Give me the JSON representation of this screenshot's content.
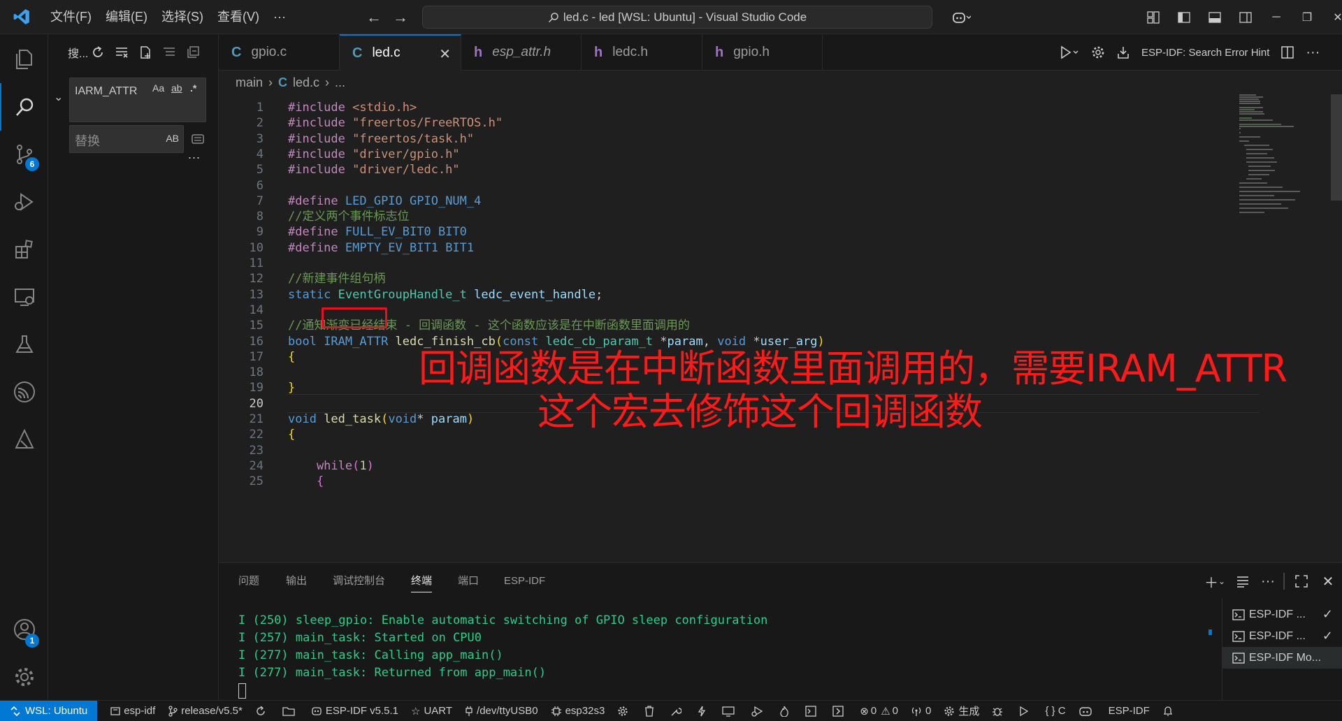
{
  "titlebar": {
    "menus": [
      "文件(F)",
      "编辑(E)",
      "选择(S)",
      "查看(V)",
      "···"
    ],
    "search_text": "led.c - led [WSL: Ubuntu] - Visual Studio Code"
  },
  "activitybar": {
    "items": [
      {
        "name": "explorer-icon"
      },
      {
        "name": "search-icon"
      },
      {
        "name": "source-control-icon",
        "badge": "6"
      },
      {
        "name": "run-debug-icon"
      },
      {
        "name": "extensions-icon"
      },
      {
        "name": "remote-explorer-icon"
      },
      {
        "name": "testing-icon"
      },
      {
        "name": "esp-idf-icon"
      },
      {
        "name": "esp-idf-explorer-icon"
      }
    ],
    "accounts_badge": "1"
  },
  "sidebar": {
    "title": "搜...",
    "find_value": "IARM_ATTR",
    "find_opts": [
      "Aa",
      "ab",
      ".*"
    ],
    "replace_placeholder": "替换",
    "replace_opt": "AB",
    "more": "..."
  },
  "tabs": [
    {
      "icon": "C",
      "label": "gpio.c",
      "active": false
    },
    {
      "icon": "C",
      "label": "led.c",
      "active": true
    },
    {
      "icon": "h",
      "label": "esp_attr.h",
      "active": false
    },
    {
      "icon": "h",
      "label": "ledc.h",
      "active": false
    },
    {
      "icon": "h",
      "label": "gpio.h",
      "active": false
    }
  ],
  "editor_actions": {
    "hint_label": "ESP-IDF: Search Error Hint"
  },
  "breadcrumb": {
    "folder": "main",
    "file": "led.c",
    "rest": "..."
  },
  "editor": {
    "line_numbers": [
      "1",
      "2",
      "3",
      "4",
      "5",
      "6",
      "7",
      "8",
      "9",
      "10",
      "11",
      "12",
      "13",
      "14",
      "15",
      "16",
      "17",
      "18",
      "19",
      "20",
      "21",
      "22",
      "23",
      "24",
      "25"
    ],
    "current_line": "20",
    "lines": {
      "l1": {
        "a": "#include",
        "b": " <stdio.h>"
      },
      "l2": {
        "a": "#include",
        "b": " \"freertos/FreeRTOS.h\""
      },
      "l3": {
        "a": "#include",
        "b": " \"freertos/task.h\""
      },
      "l4": {
        "a": "#include",
        "b": " \"driver/gpio.h\""
      },
      "l5": {
        "a": "#include",
        "b": " \"driver/ledc.h\""
      },
      "l7": {
        "a": "#define",
        "b": " LED_GPIO",
        "c": " GPIO_NUM_4"
      },
      "l8": {
        "a": "//定义两个事件标志位"
      },
      "l9": {
        "a": "#define",
        "b": " FULL_EV_BIT0",
        "c": " BIT0"
      },
      "l10": {
        "a": "#define",
        "b": " EMPTY_EV_BIT1",
        "c": " BIT1"
      },
      "l12": {
        "a": "//新建事件组句柄"
      },
      "l13": {
        "a": "static",
        "b": " EventGroupHandle_t",
        "c": " ledc_event_handle",
        "d": ";"
      },
      "l15": {
        "a": "//通知渐变已经结束 - 回调函数 - 这个函数应该是在中断函数里面调用的"
      },
      "l16": {
        "a": "bool",
        "b": " IRAM_ATTR",
        "c": " ledc_finish_cb",
        "d": "(",
        "e": "const",
        "f": " ledc_cb_param_t",
        "g": " *",
        "h": "param",
        "i": ", ",
        "j": "void",
        "k": " *",
        "l": "user_arg",
        "m": ")"
      },
      "l17": {
        "a": "{"
      },
      "l19": {
        "a": "}"
      },
      "l21": {
        "a": "void",
        "b": " led_task",
        "c": "(",
        "d": "void",
        "e": "* ",
        "f": "param",
        "g": ")"
      },
      "l22": {
        "a": "{"
      },
      "l24": {
        "a": "    while",
        "b": "(",
        "c": "1",
        "d": ")"
      },
      "l25": {
        "a": "    {"
      }
    },
    "annotation_line1": "回调函数是在中断函数里面调用的，需要IRAM_ATTR",
    "annotation_line2": "这个宏去修饰这个回调函数"
  },
  "panel": {
    "tabs": [
      "问题",
      "输出",
      "调试控制台",
      "终端",
      "端口",
      "ESP-IDF"
    ],
    "active_tab": "终端",
    "terminal_lines": [
      "I (250) sleep_gpio: Enable automatic switching of GPIO sleep configuration",
      "I (257) main_task: Started on CPU0",
      "I (277) main_task: Calling app_main()",
      "I (277) main_task: Returned from app_main()"
    ],
    "terminals": [
      {
        "label": "ESP-IDF ...",
        "check": "✓"
      },
      {
        "label": "ESP-IDF ...",
        "check": "✓"
      },
      {
        "label": "ESP-IDF Mo...",
        "check": ""
      }
    ]
  },
  "statusbar": {
    "remote": "WSL: Ubuntu",
    "project": "esp-idf",
    "branch": "release/v5.5*",
    "idf_version": "ESP-IDF v5.5.1",
    "flash_mode": "UART",
    "port": "/dev/ttyUSB0",
    "target": "esp32s3",
    "errors": "0",
    "warnings": "0",
    "ports_count": "0",
    "build": "生成",
    "language": "{ } C",
    "extension": "ESP-IDF"
  },
  "colors": {
    "accent": "#0078d4",
    "annotation": "#ff1a1a",
    "terminal_text": "#23d18b"
  }
}
